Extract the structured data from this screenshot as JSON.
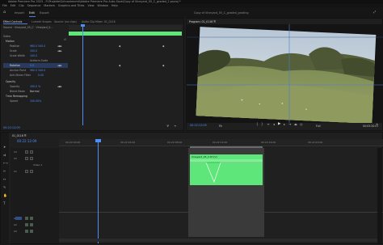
{
  "window": {
    "title": "Adobe Premiere Pro 2023 - F:\\Projekte\\Schrankenmit\\Adobe Premiere Pro Auto-Save\\Copy of Vineyard_05_C_graded_2.prproj *"
  },
  "menu": [
    "File",
    "Edit",
    "Clip",
    "Sequence",
    "Markers",
    "Graphics and Titles",
    "View",
    "Window",
    "Help"
  ],
  "workspace_tabs": [
    {
      "label": "Import",
      "active": false
    },
    {
      "label": "Edit",
      "active": true
    },
    {
      "label": "Export",
      "active": false
    }
  ],
  "left_panel": {
    "tabs": [
      "Effect Controls",
      "Lumetri Scopes",
      "Source: (no clips)",
      "Audio Clip Mixer: 01_0116"
    ],
    "source": "Source · Vineyard_05_C · Vineyard_0...",
    "section_video": "Video",
    "motion": "Motion",
    "position_label": "Position",
    "position_value": "960.0  540.0",
    "scale_label": "Scale",
    "scale_value": "100.0",
    "scale_width_label": "Scale Width",
    "scale_width_value": "100.0",
    "uniform_scale": "Uniform Scale",
    "rotation_label": "Rotation",
    "rotation_value": "0.0",
    "anchor_label": "Anchor Point",
    "anchor_value": "960.0  540.0",
    "flicker_label": "Anti-flicker Filter",
    "flicker_value": "0.00",
    "opacity": "Opacity",
    "opacity_value": "100.0 %",
    "blend_label": "Blend Mode",
    "blend_value": "Normal",
    "time_remap": "Time Remapping",
    "speed_label": "Speed",
    "speed_value": "100.00%",
    "timecode": "00:22:12:09"
  },
  "program": {
    "title": "Program: 01_0116   ☰",
    "header_right": "Copy of Vineyard_05_C_graded_grading",
    "timecode": "00:22:12:09",
    "fit": "Fit",
    "quality": "Full",
    "duration": "00:03:20:07"
  },
  "timeline": {
    "tab": "01_0116   ☰",
    "timecode": "00:22:12:09",
    "ruler": [
      "00:22:00:00",
      "00:22:04:00",
      "00:22:08:00",
      "00:22:12:00",
      "00:22:16:00",
      "00:22:20:00"
    ],
    "tracks": [
      "V3",
      "V2",
      "V1",
      "A1",
      "A2",
      "A3"
    ],
    "v1_label": "Video 1",
    "clip_label": "Vineyard_05_C.tif [V]"
  },
  "colors": {
    "accent": "#4c8ef5",
    "clip_green": "#5ee67a",
    "keyframe_green": "#57d06c"
  }
}
